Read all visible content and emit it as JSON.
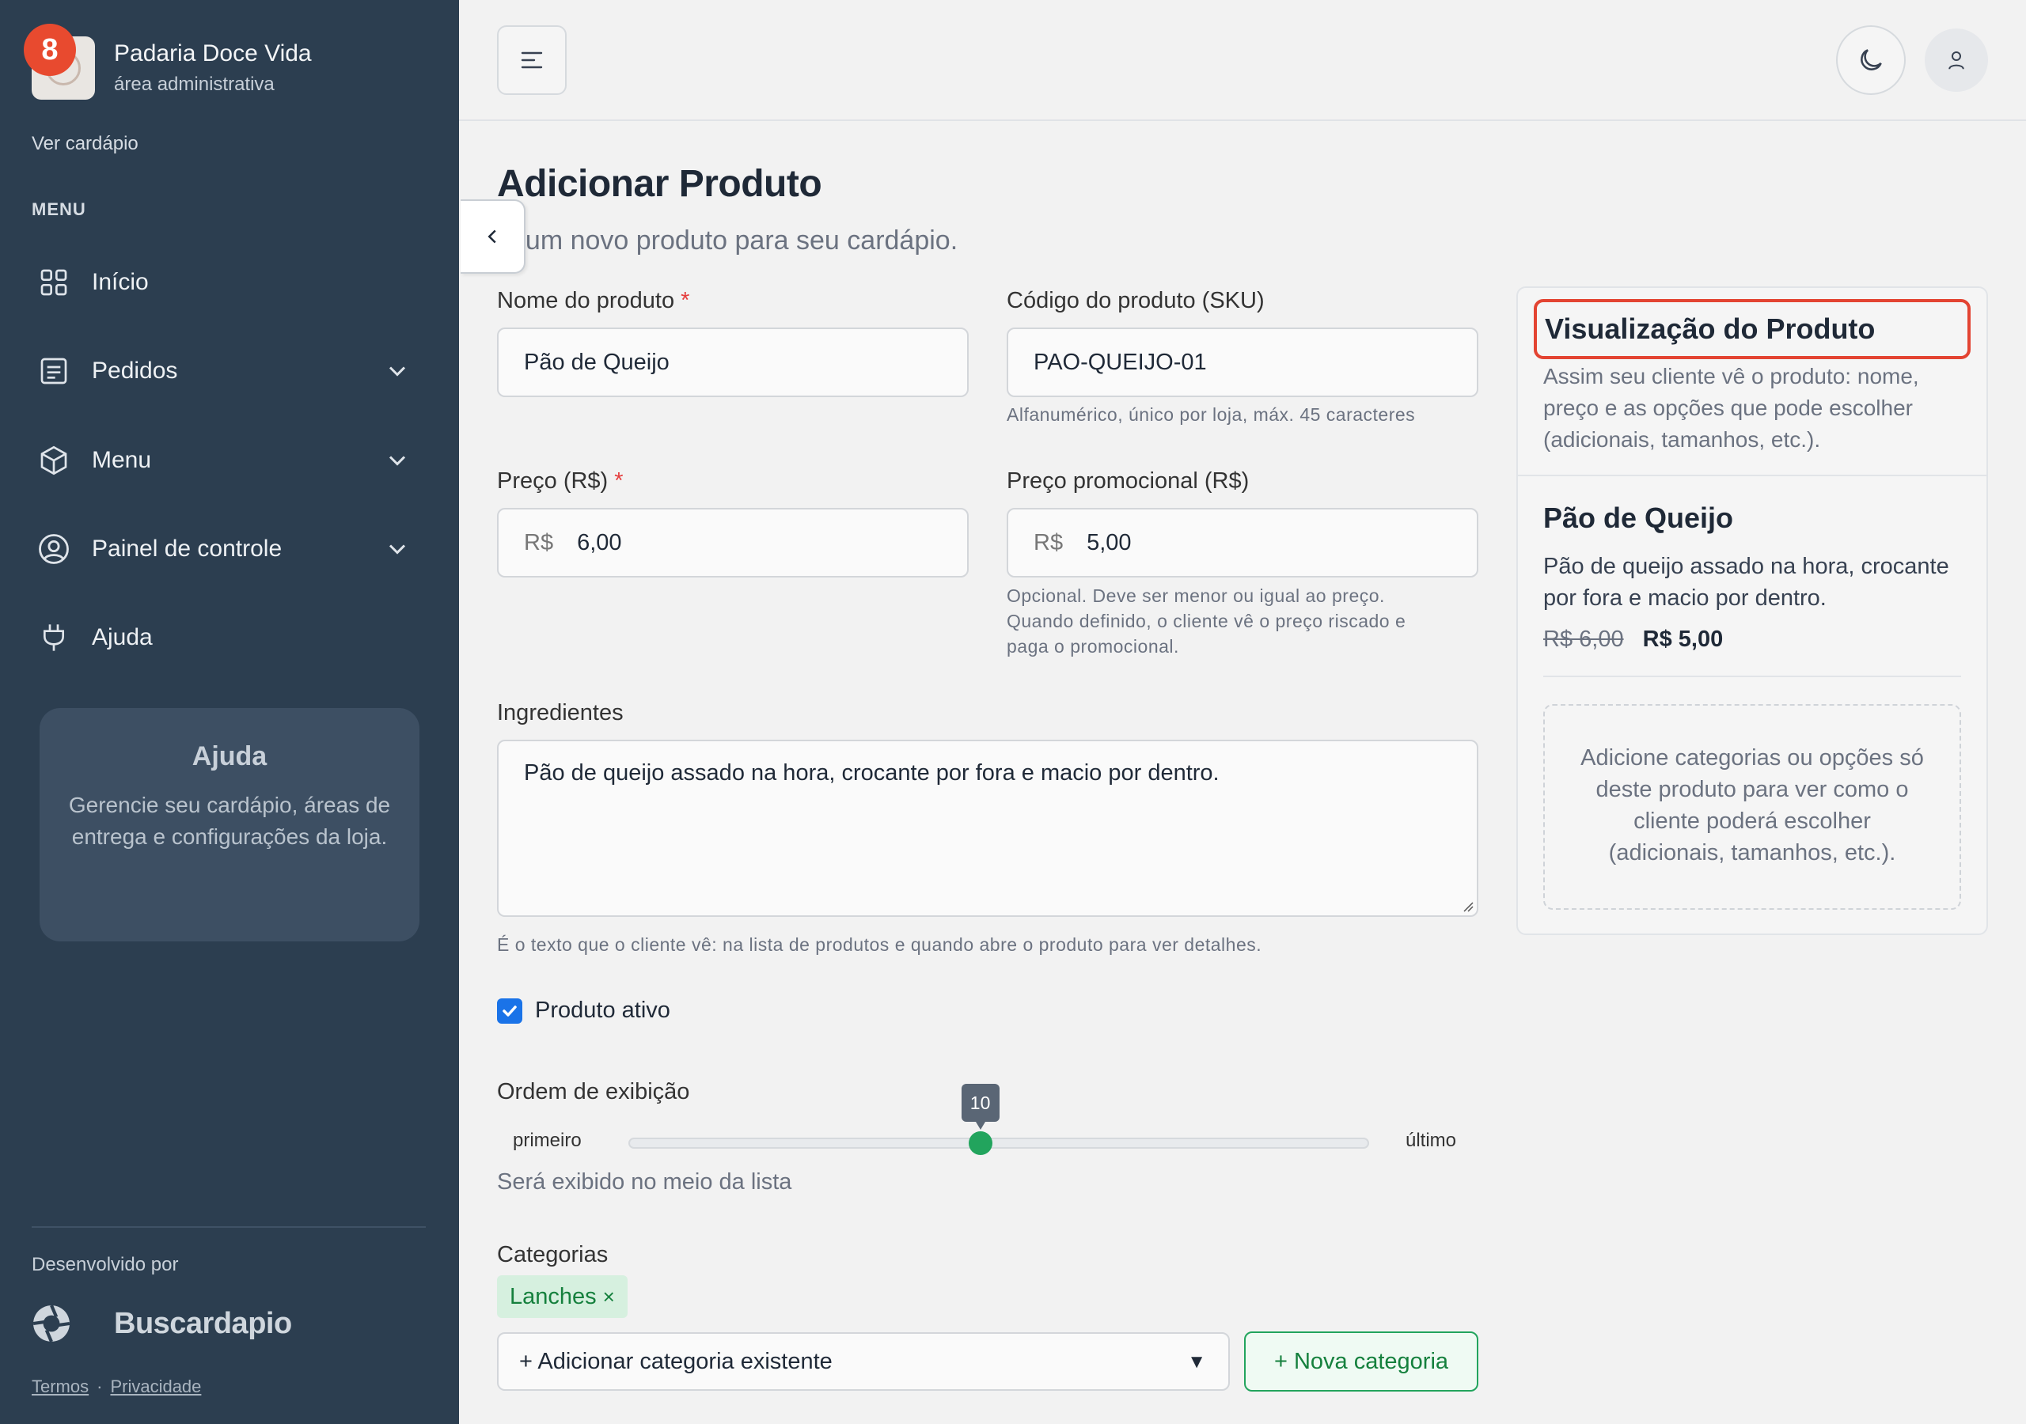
{
  "app": {
    "store_name": "Padaria Doce Vida",
    "area": "área administrativa",
    "notification_count": "8",
    "view_menu_link": "Ver cardápio"
  },
  "sidebar": {
    "section_heading": "MENU",
    "items": [
      {
        "label": "Início",
        "icon": "grid-icon",
        "expandable": false
      },
      {
        "label": "Pedidos",
        "icon": "receipt-icon",
        "expandable": true
      },
      {
        "label": "Menu",
        "icon": "box-icon",
        "expandable": true
      },
      {
        "label": "Painel de controle",
        "icon": "user-circle-icon",
        "expandable": true
      },
      {
        "label": "Ajuda",
        "icon": "plug-icon",
        "expandable": false
      }
    ],
    "help_card": {
      "title": "Ajuda",
      "text": "Gerencie seu cardápio, áreas de entrega e configurações da loja."
    },
    "developed_by": "Desenvolvido por",
    "developer_brand": "Buscardapio",
    "footer_links": {
      "terms": "Termos",
      "separator": "·",
      "privacy": "Privacidade"
    }
  },
  "topbar": {
    "menu_toggle_icon": "menu-lines-icon",
    "theme_icon": "moon-icon",
    "user_icon": "user-icon"
  },
  "page": {
    "title": "Adicionar Produto",
    "subtitle": "ie um novo produto para seu cardápio."
  },
  "form": {
    "name": {
      "label": "Nome do produto",
      "required_mark": "*",
      "value": "Pão de Queijo"
    },
    "sku": {
      "label": "Código do produto (SKU)",
      "value": "PAO-QUEIJO-01",
      "hint": "Alfanumérico, único por loja, máx. 45 caracteres"
    },
    "price": {
      "label": "Preço (R$)",
      "required_mark": "*",
      "prefix": "R$",
      "value": "6,00"
    },
    "promo_price": {
      "label": "Preço promocional (R$)",
      "prefix": "R$",
      "value": "5,00",
      "hint_lines": [
        "Opcional. Deve ser menor ou igual ao preço.",
        "Quando definido, o cliente vê o preço riscado e",
        "paga o promocional."
      ]
    },
    "ingredients": {
      "label": "Ingredientes",
      "value": "Pão de queijo assado na hora, crocante por fora e macio por dentro.",
      "hint": "É o texto que o cliente vê: na lista de produtos e quando abre o produto para ver detalhes."
    },
    "active": {
      "label": "Produto ativo",
      "checked": true
    },
    "display_order": {
      "label": "Ordem de exibição",
      "value": "10",
      "fraction": 0.475,
      "min_label": "primeiro",
      "max_label": "último",
      "note": "Será exibido no meio da lista"
    },
    "categories": {
      "label": "Categorias",
      "chips": [
        {
          "label": "Lanches",
          "remove": "×"
        }
      ],
      "select_placeholder": "+ Adicionar categoria existente",
      "select_arrow": "▼",
      "new_button": "+ Nova categoria"
    }
  },
  "preview": {
    "title": "Visualização do Produto",
    "description": "Assim seu cliente vê o produto: nome, preço e as opções que pode escolher (adicionais, tamanhos, etc.).",
    "product_name": "Pão de Queijo",
    "product_text": "Pão de queijo assado na hora, crocante por fora e macio por dentro.",
    "old_price": "R$ 6,00",
    "new_price": "R$ 5,00",
    "empty_options_text": "Adicione categorias ou opções só deste produto para ver como o cliente poderá escolher (adicionais, tamanhos, etc.)."
  },
  "colors": {
    "sidebar_bg": "#2c3e50",
    "accent_green": "#22a45d",
    "badge_red": "#e84a2f",
    "highlight_red": "#e34432",
    "checkbox_blue": "#1a73e8"
  }
}
